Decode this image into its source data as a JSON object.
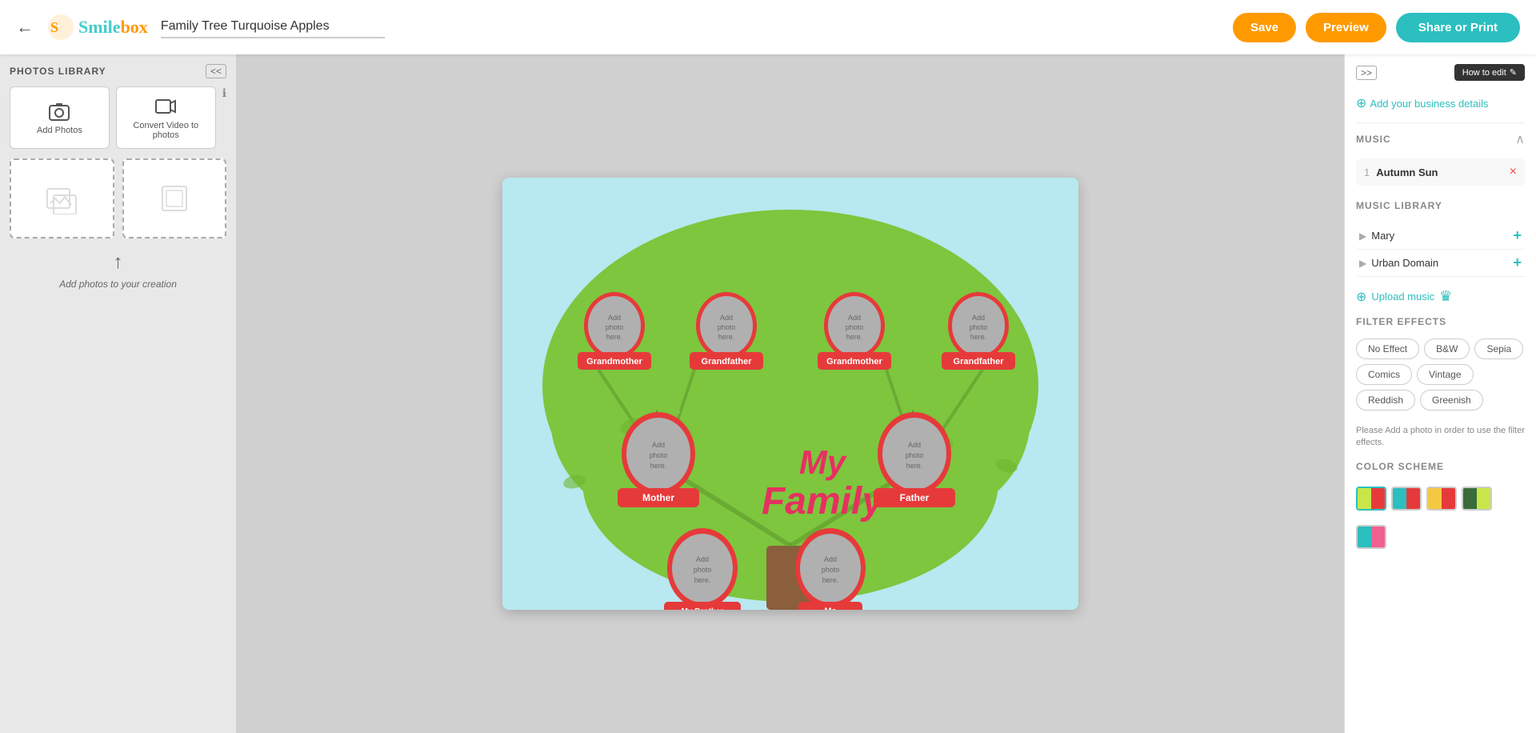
{
  "topbar": {
    "back_icon": "←",
    "logo_smile": "Smile",
    "logo_box": "box",
    "logo_full": "Smilebox",
    "project_title": "Family Tree Turquoise Apples",
    "save_label": "Save",
    "preview_label": "Preview",
    "share_label": "Share or Print"
  },
  "left_sidebar": {
    "title": "PHOTOS LIBRARY",
    "collapse_label": "<<",
    "tools": [
      {
        "name": "add-photos-tool",
        "icon": "camera",
        "label": "Add Photos"
      },
      {
        "name": "convert-video-tool",
        "icon": "video",
        "label": "Convert Video to photos"
      }
    ],
    "info_icon": "ℹ",
    "add_hint": "Add photos to your creation",
    "arrow_up": "↑"
  },
  "canvas": {
    "tree_title_line1": "My",
    "tree_title_line2": "Family",
    "slots": [
      {
        "id": "grandmother1",
        "label": "Grandmother",
        "row": 1
      },
      {
        "id": "grandfather1",
        "label": "Grandfather",
        "row": 1
      },
      {
        "id": "grandmother2",
        "label": "Grandmother",
        "row": 1
      },
      {
        "id": "grandfather2",
        "label": "Grandfather",
        "row": 1
      },
      {
        "id": "mother",
        "label": "Mother",
        "row": 2
      },
      {
        "id": "father",
        "label": "Father",
        "row": 2
      },
      {
        "id": "brother",
        "label": "My Brother",
        "row": 3
      },
      {
        "id": "me",
        "label": "Me",
        "row": 3
      }
    ],
    "add_photo_text": "Add photo here."
  },
  "right_sidebar": {
    "expand_label": ">>",
    "how_to_edit_label": "How to edit",
    "add_business_label": "Add your business details",
    "music": {
      "section_label": "MUSIC",
      "track_number": "1",
      "track_name": "Autumn Sun",
      "remove_icon": "×"
    },
    "music_library": {
      "section_label": "MUSIC LIBRARY",
      "items": [
        {
          "name": "Mary",
          "play_icon": "▶",
          "add_icon": "+"
        },
        {
          "name": "Urban Domain",
          "play_icon": "▶",
          "add_icon": "+"
        }
      ],
      "upload_label": "Upload music",
      "upload_icon": "+",
      "crown_icon": "♛"
    },
    "filter_effects": {
      "section_label": "FILTER EFFECTS",
      "filters": [
        "No Effect",
        "B&W",
        "Sepia",
        "Comics",
        "Vintage",
        "Reddish",
        "Greenish"
      ],
      "note": "Please Add a photo in order to use the filter effects."
    },
    "color_scheme": {
      "section_label": "COLOR SCHEME",
      "swatches": [
        {
          "colors": [
            "#c8e64a",
            "#e63a3a"
          ],
          "active": true
        },
        {
          "colors": [
            "#2bbfbf",
            "#e63a3a"
          ]
        },
        {
          "colors": [
            "#f5c842",
            "#e63a3a"
          ]
        },
        {
          "colors": [
            "#3a6b3a",
            "#c8e64a"
          ]
        }
      ],
      "swatches2": [
        {
          "colors": [
            "#2bbfbf",
            "#f06090"
          ]
        }
      ]
    }
  }
}
